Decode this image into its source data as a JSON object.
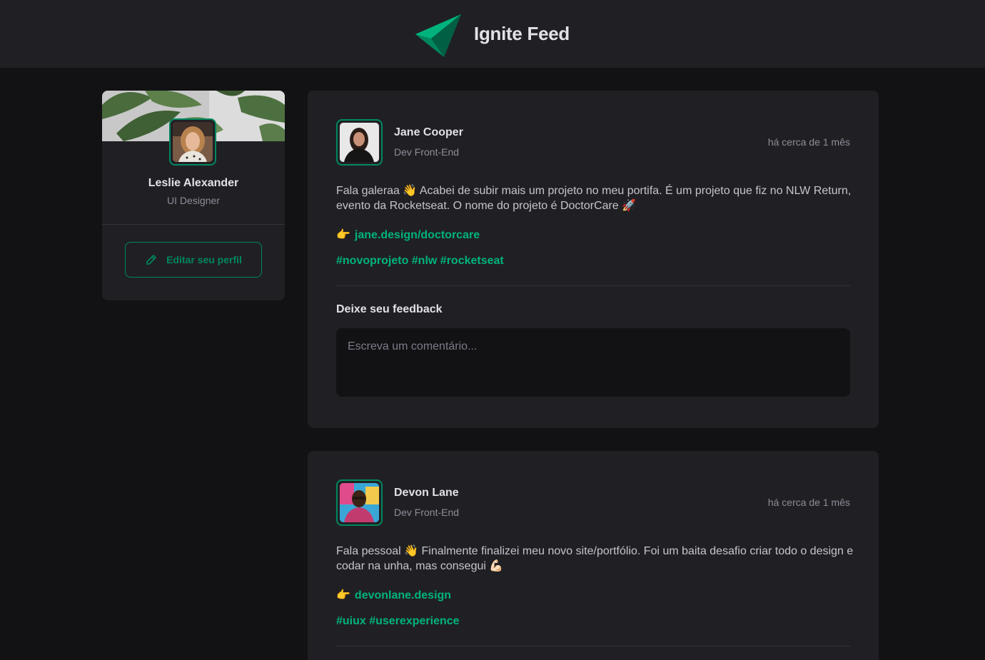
{
  "header": {
    "title": "Ignite Feed",
    "logo_icon": "ignite-logo-icon"
  },
  "colors": {
    "brand": "#00875f",
    "brand_light": "#00b37e",
    "background": "#121214",
    "surface": "#202024",
    "text": "#e1e1e6",
    "muted": "#8d8d99"
  },
  "profile": {
    "name": "Leslie Alexander",
    "role": "UI Designer",
    "edit_label": "Editar seu perfil",
    "edit_icon": "pencil-icon"
  },
  "posts": [
    {
      "author": "Jane Cooper",
      "role": "Dev Front-End",
      "time": "há cerca de 1 mês",
      "content": "Fala galeraa 👋 Acabei de subir mais um projeto no meu portifa. É um projeto que fiz no NLW Return, evento da Rocketseat. O nome do projeto é DoctorCare 🚀",
      "link_emoji": "👉",
      "link": "jane.design/doctorcare",
      "tags": "#novoprojeto #nlw #rocketseat",
      "feedback_title": "Deixe seu feedback",
      "comment_placeholder": "Escreva um comentário..."
    },
    {
      "author": "Devon Lane",
      "role": "Dev Front-End",
      "time": "há cerca de 1 mês",
      "content": "Fala pessoal 👋 Finalmente finalizei meu novo site/portfólio. Foi um baita desafio criar todo o design e codar na unha, mas consegui 💪🏻",
      "link_emoji": "👉",
      "link": "devonlane.design",
      "tags": "#uiux #userexperience"
    }
  ]
}
